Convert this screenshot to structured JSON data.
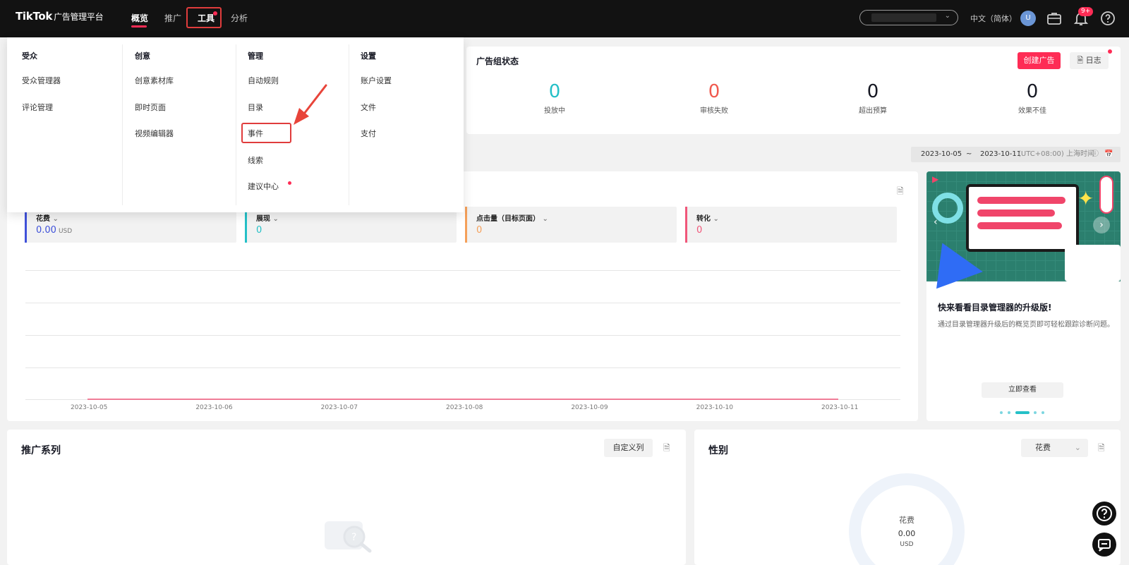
{
  "brand": {
    "logo": "TikTok",
    "subtitle": "广告管理平台"
  },
  "nav": {
    "items": [
      {
        "label": "概览"
      },
      {
        "label": "推广"
      },
      {
        "label": "工具"
      },
      {
        "label": "分析"
      }
    ],
    "language": "中文（简体）",
    "avatar_initial": "U",
    "notification_badge": "9+"
  },
  "dropdown": {
    "columns": [
      {
        "header": "受众",
        "items": [
          "受众管理器",
          "评论管理"
        ]
      },
      {
        "header": "创意",
        "items": [
          "创意素材库",
          "即时页面",
          "视频编辑器"
        ]
      },
      {
        "header": "管理",
        "items": [
          "自动规则",
          "目录",
          "事件",
          "线索",
          "建议中心"
        ]
      },
      {
        "header": "设置",
        "items": [
          "账户设置",
          "文件",
          "支付"
        ]
      }
    ]
  },
  "adgroup_status": {
    "title": "广告组状态",
    "create_button": "创建广告",
    "log_button": "日志",
    "stats": [
      {
        "value": "0",
        "label": "投放中",
        "color": "#25c0c7"
      },
      {
        "value": "0",
        "label": "审核失败",
        "color": "#f05a4f"
      },
      {
        "value": "0",
        "label": "超出预算",
        "color": "#161823"
      },
      {
        "value": "0",
        "label": "效果不佳",
        "color": "#161823"
      }
    ]
  },
  "date_range": {
    "start": "2023-10-05",
    "separator": "~",
    "end": "2023-10-11",
    "timezone": "(UTC+08:00) 上海时间"
  },
  "metrics": [
    {
      "name": "花费",
      "value": "0.00",
      "unit": "USD",
      "color": "#3f51d9"
    },
    {
      "name": "展现",
      "value": "0",
      "unit": "",
      "color": "#25c0c7"
    },
    {
      "name": "点击量（目标页面）",
      "value": "0",
      "unit": "",
      "color": "#f5a05a"
    },
    {
      "name": "转化",
      "value": "0",
      "unit": "",
      "color": "#f0577a"
    }
  ],
  "chart_data": {
    "type": "line",
    "x": [
      "2023-10-05",
      "2023-10-06",
      "2023-10-07",
      "2023-10-08",
      "2023-10-09",
      "2023-10-10",
      "2023-10-11"
    ],
    "series": [
      {
        "values": [
          0,
          0,
          0,
          0,
          0,
          0,
          0
        ],
        "color": "#f0577a"
      }
    ],
    "grid": true
  },
  "promo": {
    "title": "快来看看目录管理器的升级版!",
    "description": "通过目录管理器升级后的概览页即可轻松跟踪诊断问题。",
    "button": "立即查看"
  },
  "campaigns": {
    "title": "推广系列",
    "customize_button": "自定义列"
  },
  "gender": {
    "title": "性别",
    "select_value": "花费",
    "donut_label": "花费",
    "donut_value": "0.00",
    "donut_unit": "USD"
  }
}
